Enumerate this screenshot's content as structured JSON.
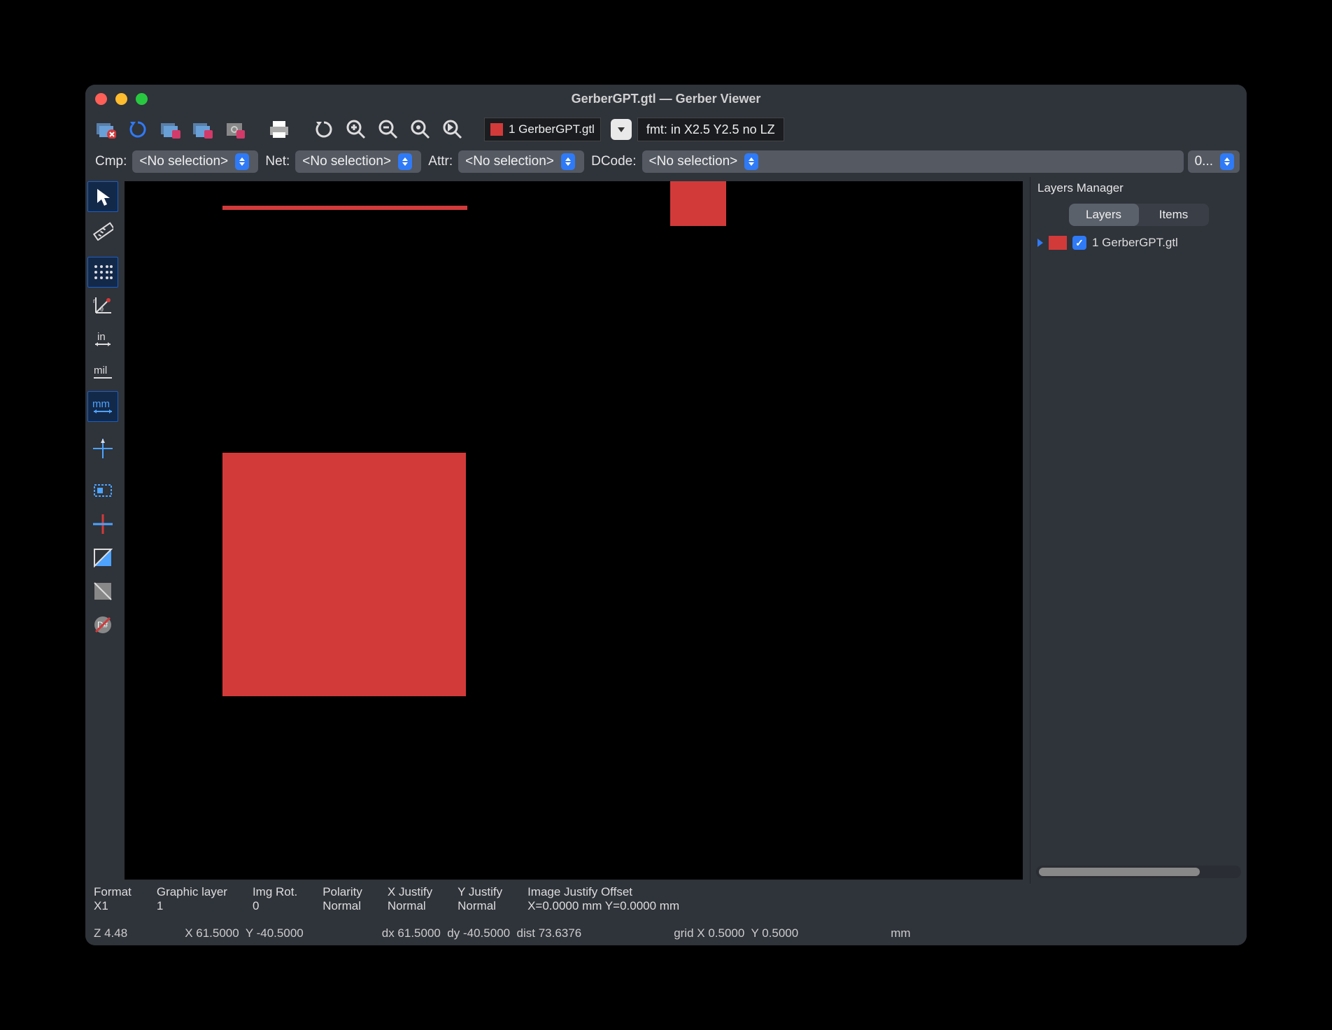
{
  "window": {
    "title": "GerberGPT.gtl — Gerber Viewer"
  },
  "toolbar": {
    "file_label": "1 GerberGPT.gtl",
    "fmt_label": "fmt: in X2.5 Y2.5 no LZ"
  },
  "filters": {
    "cmp_label": "Cmp:",
    "cmp_value": "<No selection>",
    "net_label": "Net:",
    "net_value": "<No selection>",
    "attr_label": "Attr:",
    "attr_value": "<No selection>",
    "dcode_label": "DCode:",
    "dcode_value": "<No selection>",
    "extra_value": "0..."
  },
  "left_tools": {
    "in": "in",
    "mil": "mil",
    "mm": "mm"
  },
  "layers_panel": {
    "title": "Layers Manager",
    "tab_layers": "Layers",
    "tab_items": "Items",
    "layer1": "1 GerberGPT.gtl"
  },
  "status": {
    "format_h": "Format",
    "format_v": "X1",
    "glayer_h": "Graphic layer",
    "glayer_v": "1",
    "imgrot_h": "Img Rot.",
    "imgrot_v": "0",
    "pol_h": "Polarity",
    "pol_v": "Normal",
    "xj_h": "X Justify",
    "xj_v": "Normal",
    "yj_h": "Y Justify",
    "yj_v": "Normal",
    "ijo_h": "Image Justify Offset",
    "ijo_v": "X=0.0000 mm Y=0.0000 mm"
  },
  "statusbar": {
    "zoom": "Z 4.48",
    "xy": "X 61.5000  Y -40.5000",
    "dxy": "dx 61.5000  dy -40.5000  dist 73.6376",
    "grid": "grid X 0.5000  Y 0.5000",
    "units": "mm"
  }
}
